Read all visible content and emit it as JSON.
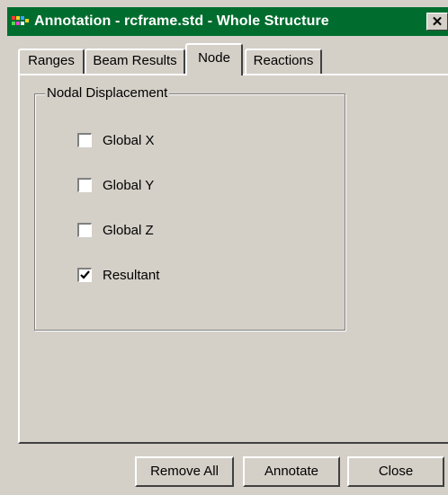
{
  "window": {
    "title": "Annotation - rcframe.std - Whole Structure",
    "close_glyph": "✕",
    "app_icon": "staad-app-icon"
  },
  "tabs": [
    {
      "label": "Ranges",
      "active": false
    },
    {
      "label": "Beam Results",
      "active": false
    },
    {
      "label": "Node",
      "active": true
    },
    {
      "label": "Reactions",
      "active": false
    }
  ],
  "group": {
    "legend": "Nodal Displacement",
    "options": [
      {
        "label": "Global X",
        "checked": false
      },
      {
        "label": "Global Y",
        "checked": false
      },
      {
        "label": "Global Z",
        "checked": false
      },
      {
        "label": "Resultant",
        "checked": true
      }
    ]
  },
  "buttons": {
    "remove_all": "Remove All",
    "annotate": "Annotate",
    "close": "Close"
  },
  "colors": {
    "titlebar": "#006d2e",
    "face": "#d4d0c8"
  }
}
